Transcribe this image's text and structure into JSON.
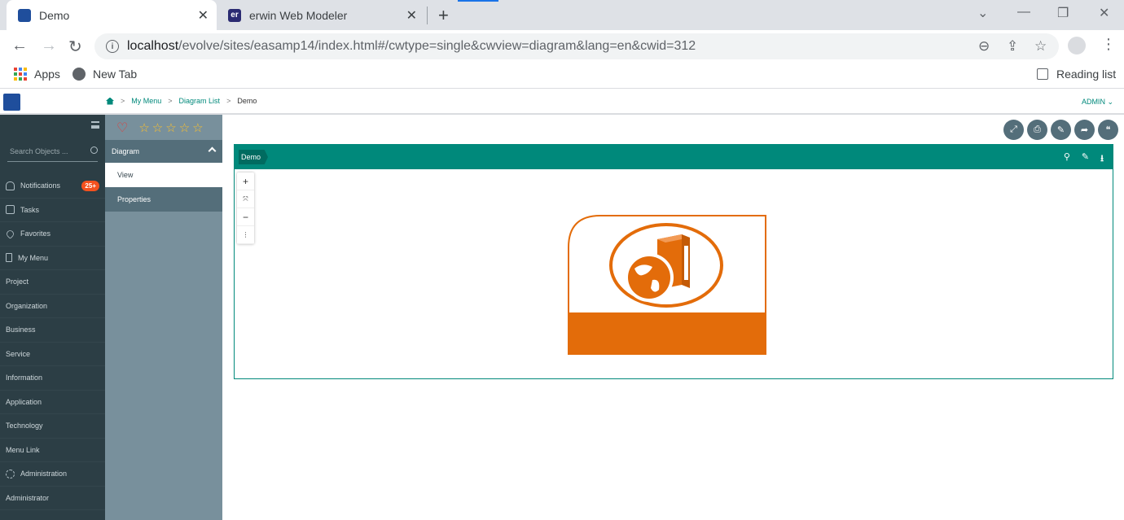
{
  "browser": {
    "tabs": [
      {
        "title": "Demo",
        "active": true,
        "icon": "evolve-logo-icon"
      },
      {
        "title": "erwin Web Modeler",
        "active": false,
        "icon": "erwin-er-icon",
        "icon_text": "er"
      }
    ],
    "address": {
      "host": "localhost",
      "path": "/evolve/sites/easamp14/index.html#/cwtype=single&cwview=diagram&lang=en&cwid=312"
    },
    "bookmarks": [
      {
        "label": "Apps",
        "icon": "apps-grid-icon"
      },
      {
        "label": "New Tab",
        "icon": "globe-icon"
      }
    ],
    "reading_list": "Reading list",
    "accent_color": "#1a73e8"
  },
  "app": {
    "breadcrumb": [
      "My Menu",
      "Diagram List",
      "Demo"
    ],
    "user": "ADMIN",
    "brand_color": "#00897b"
  },
  "sidebar": {
    "search_placeholder": "Search Objects ...",
    "items": [
      {
        "label": "Notifications",
        "icon": "bell-icon",
        "badge": "25+"
      },
      {
        "label": "Tasks",
        "icon": "check-square-icon"
      },
      {
        "label": "Favorites",
        "icon": "heart-icon"
      },
      {
        "label": "My Menu",
        "icon": "bookmark-icon"
      },
      {
        "label": "Project"
      },
      {
        "label": "Organization"
      },
      {
        "label": "Business"
      },
      {
        "label": "Service"
      },
      {
        "label": "Information"
      },
      {
        "label": "Application"
      },
      {
        "label": "Technology"
      },
      {
        "label": "Menu Link"
      },
      {
        "label": "Administration",
        "icon": "gears-icon"
      },
      {
        "label": "Administrator"
      }
    ]
  },
  "panel": {
    "stars": 5,
    "section": "Diagram",
    "items": [
      "View",
      "Properties"
    ]
  },
  "actions": [
    "expand-icon",
    "print-icon",
    "edit-icon",
    "share-icon",
    "comment-icon"
  ],
  "card": {
    "tag": "Demo",
    "header_icons": [
      "map-marker-icon",
      "edit-icon",
      "download-icon"
    ],
    "zoom_controls": [
      "+",
      "⤧",
      "−",
      "⋮"
    ],
    "diagram_color": "#e36c0a"
  }
}
